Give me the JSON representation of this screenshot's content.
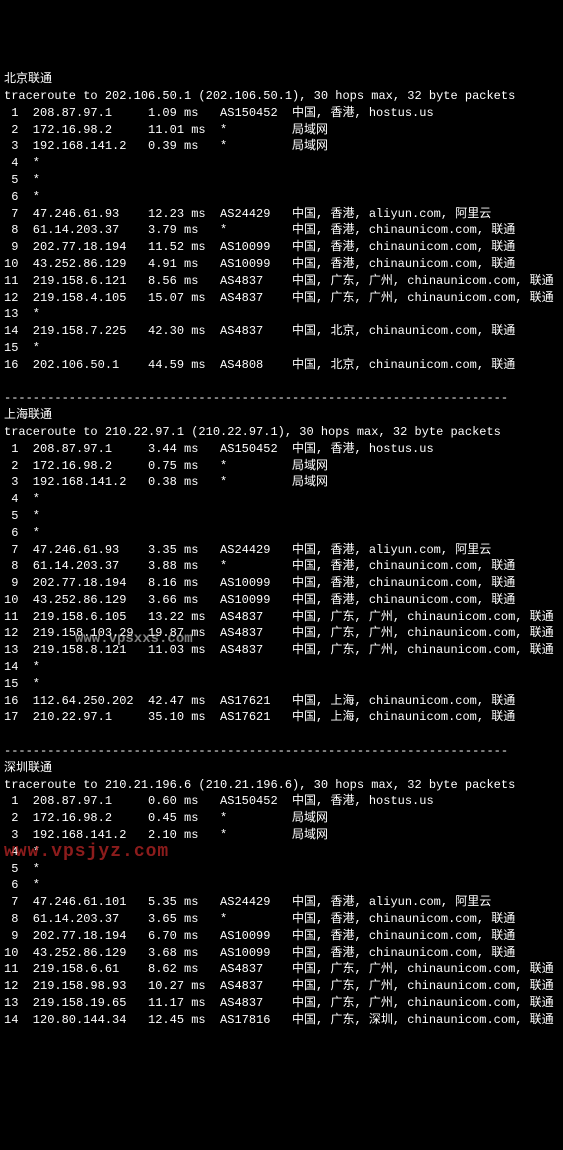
{
  "sections": [
    {
      "title": "北京联通",
      "header": "traceroute to 202.106.50.1 (202.106.50.1), 30 hops max, 32 byte packets",
      "hops": [
        {
          "n": " 1",
          "ip": "208.87.97.1",
          "ms": "1.09 ms",
          "as": "AS150452",
          "loc": "中国, 香港, hostus.us"
        },
        {
          "n": " 2",
          "ip": "172.16.98.2",
          "ms": "11.01 ms",
          "as": "*",
          "loc": "局域网"
        },
        {
          "n": " 3",
          "ip": "192.168.141.2",
          "ms": "0.39 ms",
          "as": "*",
          "loc": "局域网"
        },
        {
          "n": " 4",
          "ip": "*",
          "ms": "",
          "as": "",
          "loc": ""
        },
        {
          "n": " 5",
          "ip": "*",
          "ms": "",
          "as": "",
          "loc": ""
        },
        {
          "n": " 6",
          "ip": "*",
          "ms": "",
          "as": "",
          "loc": ""
        },
        {
          "n": " 7",
          "ip": "47.246.61.93",
          "ms": "12.23 ms",
          "as": "AS24429",
          "loc": "中国, 香港, aliyun.com, 阿里云"
        },
        {
          "n": " 8",
          "ip": "61.14.203.37",
          "ms": "3.79 ms",
          "as": "*",
          "loc": "中国, 香港, chinaunicom.com, 联通"
        },
        {
          "n": " 9",
          "ip": "202.77.18.194",
          "ms": "11.52 ms",
          "as": "AS10099",
          "loc": "中国, 香港, chinaunicom.com, 联通"
        },
        {
          "n": "10",
          "ip": "43.252.86.129",
          "ms": "4.91 ms",
          "as": "AS10099",
          "loc": "中国, 香港, chinaunicom.com, 联通"
        },
        {
          "n": "11",
          "ip": "219.158.6.121",
          "ms": "8.56 ms",
          "as": "AS4837",
          "loc": "中国, 广东, 广州, chinaunicom.com, 联通"
        },
        {
          "n": "12",
          "ip": "219.158.4.105",
          "ms": "15.07 ms",
          "as": "AS4837",
          "loc": "中国, 广东, 广州, chinaunicom.com, 联通"
        },
        {
          "n": "13",
          "ip": "*",
          "ms": "",
          "as": "",
          "loc": ""
        },
        {
          "n": "14",
          "ip": "219.158.7.225",
          "ms": "42.30 ms",
          "as": "AS4837",
          "loc": "中国, 北京, chinaunicom.com, 联通"
        },
        {
          "n": "15",
          "ip": "*",
          "ms": "",
          "as": "",
          "loc": ""
        },
        {
          "n": "16",
          "ip": "202.106.50.1",
          "ms": "44.59 ms",
          "as": "AS4808",
          "loc": "中国, 北京, chinaunicom.com, 联通"
        }
      ]
    },
    {
      "title": "上海联通",
      "header": "traceroute to 210.22.97.1 (210.22.97.1), 30 hops max, 32 byte packets",
      "hops": [
        {
          "n": " 1",
          "ip": "208.87.97.1",
          "ms": "3.44 ms",
          "as": "AS150452",
          "loc": "中国, 香港, hostus.us"
        },
        {
          "n": " 2",
          "ip": "172.16.98.2",
          "ms": "0.75 ms",
          "as": "*",
          "loc": "局域网"
        },
        {
          "n": " 3",
          "ip": "192.168.141.2",
          "ms": "0.38 ms",
          "as": "*",
          "loc": "局域网"
        },
        {
          "n": " 4",
          "ip": "*",
          "ms": "",
          "as": "",
          "loc": ""
        },
        {
          "n": " 5",
          "ip": "*",
          "ms": "",
          "as": "",
          "loc": ""
        },
        {
          "n": " 6",
          "ip": "*",
          "ms": "",
          "as": "",
          "loc": ""
        },
        {
          "n": " 7",
          "ip": "47.246.61.93",
          "ms": "3.35 ms",
          "as": "AS24429",
          "loc": "中国, 香港, aliyun.com, 阿里云"
        },
        {
          "n": " 8",
          "ip": "61.14.203.37",
          "ms": "3.88 ms",
          "as": "*",
          "loc": "中国, 香港, chinaunicom.com, 联通"
        },
        {
          "n": " 9",
          "ip": "202.77.18.194",
          "ms": "8.16 ms",
          "as": "AS10099",
          "loc": "中国, 香港, chinaunicom.com, 联通"
        },
        {
          "n": "10",
          "ip": "43.252.86.129",
          "ms": "3.66 ms",
          "as": "AS10099",
          "loc": "中国, 香港, chinaunicom.com, 联通"
        },
        {
          "n": "11",
          "ip": "219.158.6.105",
          "ms": "13.22 ms",
          "as": "AS4837",
          "loc": "中国, 广东, 广州, chinaunicom.com, 联通"
        },
        {
          "n": "12",
          "ip": "219.158.103.29",
          "ms": "19.87 ms",
          "as": "AS4837",
          "loc": "中国, 广东, 广州, chinaunicom.com, 联通"
        },
        {
          "n": "13",
          "ip": "219.158.8.121",
          "ms": "11.03 ms",
          "as": "AS4837",
          "loc": "中国, 广东, 广州, chinaunicom.com, 联通"
        },
        {
          "n": "14",
          "ip": "*",
          "ms": "",
          "as": "",
          "loc": ""
        },
        {
          "n": "15",
          "ip": "*",
          "ms": "",
          "as": "",
          "loc": ""
        },
        {
          "n": "16",
          "ip": "112.64.250.202",
          "ms": "42.47 ms",
          "as": "AS17621",
          "loc": "中国, 上海, chinaunicom.com, 联通"
        },
        {
          "n": "17",
          "ip": "210.22.97.1",
          "ms": "35.10 ms",
          "as": "AS17621",
          "loc": "中国, 上海, chinaunicom.com, 联通"
        }
      ]
    },
    {
      "title": "深圳联通",
      "header": "traceroute to 210.21.196.6 (210.21.196.6), 30 hops max, 32 byte packets",
      "hops": [
        {
          "n": " 1",
          "ip": "208.87.97.1",
          "ms": "0.60 ms",
          "as": "AS150452",
          "loc": "中国, 香港, hostus.us"
        },
        {
          "n": " 2",
          "ip": "172.16.98.2",
          "ms": "0.45 ms",
          "as": "*",
          "loc": "局域网"
        },
        {
          "n": " 3",
          "ip": "192.168.141.2",
          "ms": "2.10 ms",
          "as": "*",
          "loc": "局域网"
        },
        {
          "n": " 4",
          "ip": "*",
          "ms": "",
          "as": "",
          "loc": ""
        },
        {
          "n": " 5",
          "ip": "*",
          "ms": "",
          "as": "",
          "loc": ""
        },
        {
          "n": " 6",
          "ip": "*",
          "ms": "",
          "as": "",
          "loc": ""
        },
        {
          "n": " 7",
          "ip": "47.246.61.101",
          "ms": "5.35 ms",
          "as": "AS24429",
          "loc": "中国, 香港, aliyun.com, 阿里云"
        },
        {
          "n": " 8",
          "ip": "61.14.203.37",
          "ms": "3.65 ms",
          "as": "*",
          "loc": "中国, 香港, chinaunicom.com, 联通"
        },
        {
          "n": " 9",
          "ip": "202.77.18.194",
          "ms": "6.70 ms",
          "as": "AS10099",
          "loc": "中国, 香港, chinaunicom.com, 联通"
        },
        {
          "n": "10",
          "ip": "43.252.86.129",
          "ms": "3.68 ms",
          "as": "AS10099",
          "loc": "中国, 香港, chinaunicom.com, 联通"
        },
        {
          "n": "11",
          "ip": "219.158.6.61",
          "ms": "8.62 ms",
          "as": "AS4837",
          "loc": "中国, 广东, 广州, chinaunicom.com, 联通"
        },
        {
          "n": "12",
          "ip": "219.158.98.93",
          "ms": "10.27 ms",
          "as": "AS4837",
          "loc": "中国, 广东, 广州, chinaunicom.com, 联通"
        },
        {
          "n": "13",
          "ip": "219.158.19.65",
          "ms": "11.17 ms",
          "as": "AS4837",
          "loc": "中国, 广东, 广州, chinaunicom.com, 联通"
        },
        {
          "n": "14",
          "ip": "120.80.144.34",
          "ms": "12.45 ms",
          "as": "AS17816",
          "loc": "中国, 广东, 深圳, chinaunicom.com, 联通"
        }
      ]
    }
  ],
  "separator": "----------------------------------------------------------------------",
  "watermark1": "www.vpsxxs.com",
  "watermark2": "www.vpsjyz.com"
}
